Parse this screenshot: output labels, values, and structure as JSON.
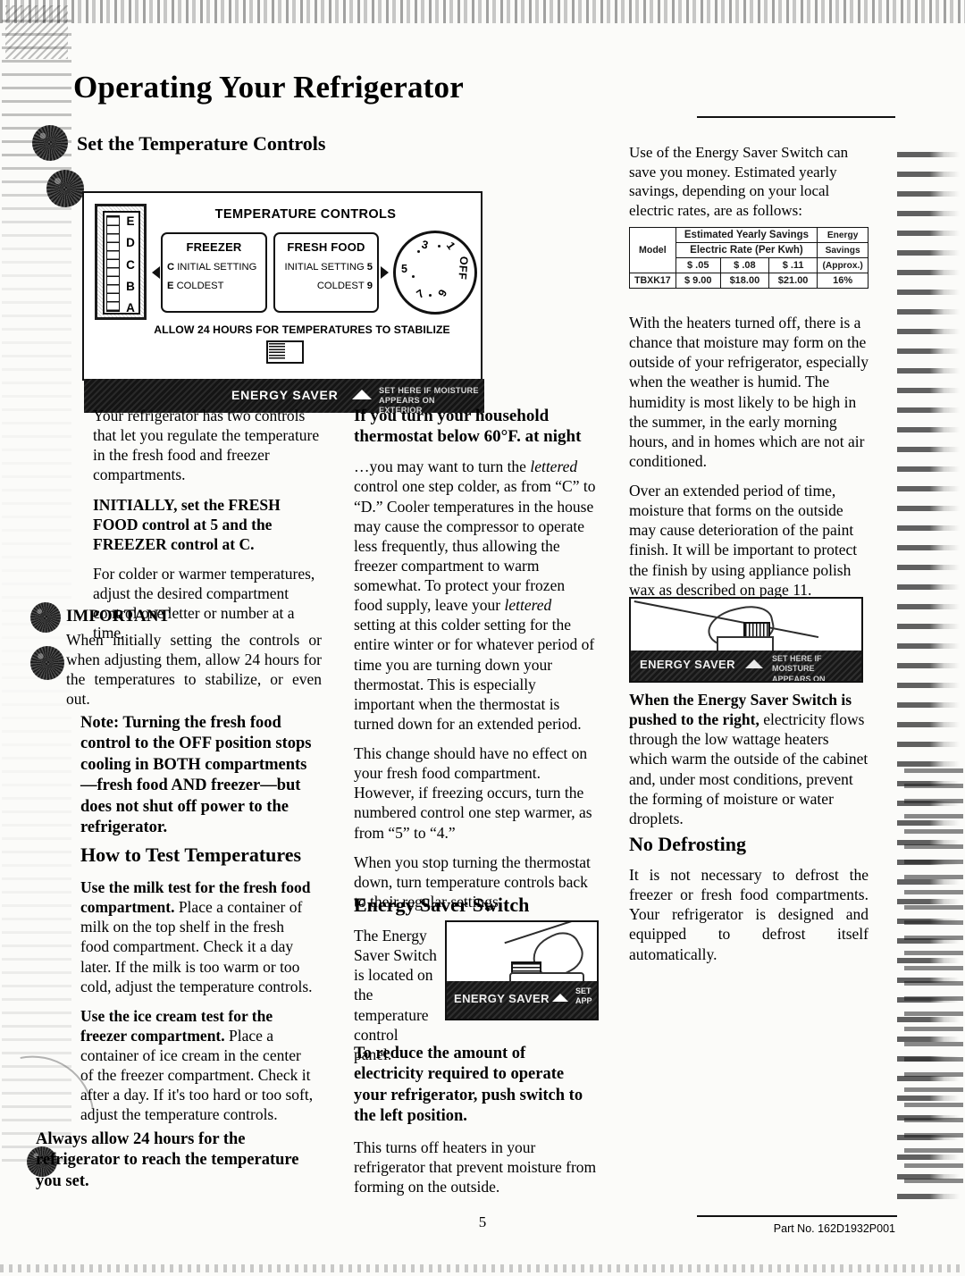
{
  "document": {
    "title": "Operating Your Refrigerator",
    "page_number": "5",
    "part_number": "Part No. 162D1932P001"
  },
  "sections": {
    "set_controls": {
      "heading": "Set the Temperature Controls"
    },
    "how_to_test": {
      "heading": "How to Test Temperatures"
    },
    "energy_saver": {
      "heading": "Energy Saver Switch"
    },
    "no_defrosting": {
      "heading": "No Defrosting"
    }
  },
  "control_panel": {
    "title": "TEMPERATURE CONTROLS",
    "slider_letters": [
      "E",
      "D",
      "C",
      "B",
      "A"
    ],
    "freezer": {
      "header": "FREEZER",
      "rows": [
        {
          "letter": "C",
          "label": "INITIAL SETTING"
        },
        {
          "letter": "E",
          "label": "COLDEST"
        }
      ]
    },
    "fresh_food": {
      "header": "FRESH FOOD",
      "rows": [
        {
          "label": "INITIAL SETTING",
          "value": "5"
        },
        {
          "label": "COLDEST",
          "value": "9"
        }
      ]
    },
    "dial_labels": [
      "1",
      "3",
      "5",
      "7",
      "9",
      "OFF"
    ],
    "stabilize_note": "ALLOW 24 HOURS FOR TEMPERATURES TO STABILIZE",
    "strip": {
      "energy_saver_label": "ENERGY SAVER",
      "set_here_line1": "SET HERE IF MOISTURE",
      "set_here_line2": "APPEARS ON EXTERIOR"
    }
  },
  "left_column": {
    "intro": "Your refrigerator has two controls that let you regulate the temperature in the fresh food and freezer compartments.",
    "initially_bold": "INITIALLY, set the FRESH FOOD control at 5 and the FREEZER control at C.",
    "colder_warmer": "For colder or warmer temperatures, adjust the desired compartment control one letter or number at a time.",
    "important_heading": "IMPORTANT",
    "important_body": "When initially setting the controls or when adjusting them, allow 24 hours for the temperatures to stabilize, or even out.",
    "note_bold": "Note: Turning the fresh food control to the OFF position stops cooling in BOTH compartments—fresh food AND freezer—but does not shut off power to the refrigerator.",
    "milk_test_bold": "Use the milk test for the fresh food compartment.",
    "milk_test_rest": " Place a container of milk on the top shelf in the fresh food compartment. Check it a day later. If the milk is too warm or too cold, adjust the temperature controls.",
    "ice_cream_bold": "Use the ice cream test for the freezer compartment.",
    "ice_cream_rest": " Place a container of ice cream in the center of the freezer compartment. Check it after a day. If it's too hard or too soft, adjust the temperature controls.",
    "always_allow": "Always allow 24 hours for the refrigerator to reach the temperature you set."
  },
  "middle_column": {
    "thermostat_heading": "If you turn your household thermostat below 60°F. at night",
    "thermostat_p1_a": "…you may want to turn the ",
    "thermostat_p1_italic": "lettered",
    "thermostat_p1_b": " control one step colder, as from “C” to “D.” Cooler temperatures in the house may cause the compressor to operate less frequently, thus allowing the freezer compartment to warm somewhat. To protect your frozen food supply, leave your ",
    "thermostat_p1_italic2": "lettered",
    "thermostat_p1_c": " setting at this colder setting for the entire winter or for whatever period of time you are turning down your thermostat. This is especially important when the thermostat is turned down for an extended period.",
    "thermostat_p2": "This change should have no effect on your fresh food compartment. However, if freezing occurs, turn the numbered control one step warmer, as from “5” to “4.”",
    "thermostat_p3": "When you stop turning the thermostat down, turn temperature controls back to their regular settings.",
    "es_located": "The Energy Saver Switch is located on the temperature control panel.",
    "es_reduce_bold": "To reduce the amount of electricity required to operate your refrigerator, push switch to the left position.",
    "es_turns_off": "This turns off heaters in your refrigerator that prevent moisture from forming on the outside."
  },
  "right_column": {
    "savings_intro": "Use of the Energy Saver Switch can save you money. Estimated yearly savings, depending on your local electric rates, are as follows:",
    "heaters_off": "With the heaters turned off, there is a chance that moisture may form on the outside of your refrigerator, especially when the weather is humid. The humidity is most likely to be high in the summer, in the early morning hours, and in homes which are not air conditioned.",
    "over_time": "Over an extended period of time, moisture that forms on the outside may cause deterioration of the paint finish. It will be important to protect the finish by using appliance polish wax as described on page 11.",
    "pushed_right_bold": "When the Energy Saver Switch is pushed to the right,",
    "pushed_right_rest": " electricity flows through the low wattage heaters which warm the outside of the cabinet and, under most conditions, prevent the forming of moisture or water droplets.",
    "no_defrosting_body": "It is not necessary to defrost the freezer or fresh food compartments. Your refrigerator is designed and equipped to defrost itself automatically."
  },
  "savings_table": {
    "col_model": "Model",
    "col_estimated": "Estimated Yearly Savings",
    "col_rate": "Electric Rate (Per Kwh)",
    "col_energy_1": "Energy",
    "col_energy_2": "Savings",
    "col_energy_3": "(Approx.)",
    "rates": [
      "$   .05",
      "$   .08",
      "$   .11"
    ],
    "rows": [
      {
        "model": "TBXK17",
        "v05": "$  9.00",
        "v08": "$18.00",
        "v11": "$21.00",
        "pct": "16%"
      }
    ]
  },
  "figures": {
    "energy_saver_mid": {
      "label": "ENERGY SAVER",
      "set_line1": "SET",
      "set_line2": "APP"
    },
    "energy_saver_right": {
      "label": "ENERGY SAVER",
      "set_line1": "SET HERE IF MOISTURE",
      "set_line2": "APPEARS ON EXTERIOR"
    }
  },
  "colors": {
    "ink": "#111111",
    "paper": "#fbfbf9",
    "strip": "#171717"
  }
}
